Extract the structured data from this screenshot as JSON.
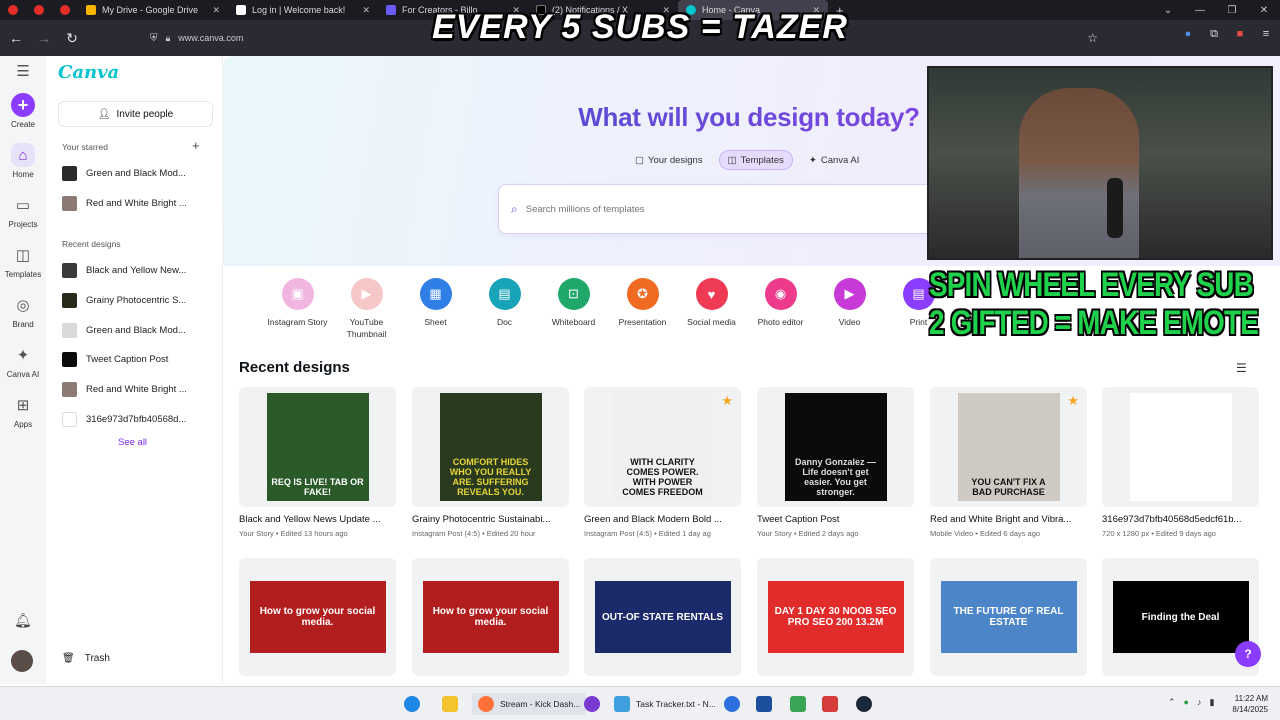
{
  "browser": {
    "tabs": [
      {
        "title": "My Drive - Google Drive",
        "color": "#f4b400"
      },
      {
        "title": "Log in | Welcome back!",
        "color": "#ffffff"
      },
      {
        "title": "For Creators - Billo",
        "color": "#6b5bff"
      },
      {
        "title": "(2) Notifications / X",
        "color": "#000000"
      },
      {
        "title": "Home - Canva",
        "color": "#00c4cc"
      }
    ],
    "url": "www.canva.com"
  },
  "overlay": {
    "top_banner": "EVERY 5 SUBS = TAZER",
    "side_line1": "SPIN WHEEL EVERY SUB",
    "side_line2": "2 GIFTED = MAKE EMOTE"
  },
  "rail": {
    "create": "Create",
    "home": "Home",
    "projects": "Projects",
    "templates": "Templates",
    "brand": "Brand",
    "canva_ai": "Canva AI",
    "apps": "Apps"
  },
  "sidepanel": {
    "logo": "Canva",
    "invite": "Invite people",
    "starred_heading": "Your starred",
    "starred": [
      "Green and Black Mod...",
      "Red and White Bright ..."
    ],
    "recent_heading": "Recent designs",
    "recent": [
      "Black and Yellow New...",
      "Grainy Photocentric S...",
      "Green and Black Mod...",
      "Tweet Caption Post",
      "Red and White Bright ...",
      "316e973d7bfb40568d..."
    ],
    "see_all": "See all",
    "trash": "Trash"
  },
  "hero": {
    "title": "What will you design today?",
    "modes": [
      "Your designs",
      "Templates",
      "Canva AI"
    ],
    "active_mode": "Templates",
    "search_placeholder": "Search millions of templates"
  },
  "design_types": [
    {
      "label": "Instagram Story",
      "color": "#f1b6e0"
    },
    {
      "label": "YouTube Thumbnail",
      "color": "#f5c7c7"
    },
    {
      "label": "Sheet",
      "color": "#2f7fe6"
    },
    {
      "label": "Doc",
      "color": "#17a3b8"
    },
    {
      "label": "Whiteboard",
      "color": "#20a86a"
    },
    {
      "label": "Presentation",
      "color": "#f06a22"
    },
    {
      "label": "Social media",
      "color": "#ee3a55"
    },
    {
      "label": "Photo editor",
      "color": "#ee3a8a"
    },
    {
      "label": "Video",
      "color": "#c83ad8"
    },
    {
      "label": "Print",
      "color": "#8b3dff"
    }
  ],
  "recent": {
    "heading": "Recent designs",
    "row1": [
      {
        "name": "Black and Yellow News Update ...",
        "meta": "Your Story • Edited 13 hours ago",
        "art_text": "REQ IS LIVE! TAB OR FAKE!",
        "bg": "#2b5a2a",
        "fg": "#ffffff"
      },
      {
        "name": "Grainy Photocentric Sustainabi...",
        "meta": "Instagram Post (4:5) • Edited 20 hour",
        "art_text": "COMFORT HIDES WHO YOU REALLY ARE. SUFFERING REVEALS YOU.",
        "bg": "#2a3a1e",
        "fg": "#e6d63a"
      },
      {
        "name": "Green and Black Modern Bold ...",
        "meta": "Instagram Post (4:5) • Edited 1 day ag",
        "art_text": "WITH CLARITY COMES POWER. WITH POWER COMES FREEDOM",
        "bg": "#f0f0f0",
        "fg": "#111111"
      },
      {
        "name": "Tweet Caption Post",
        "meta": "Your Story • Edited 2 days ago",
        "art_text": "Danny Gonzalez — Life doesn't get easier. You get stronger.",
        "bg": "#0b0b0b",
        "fg": "#dddddd"
      },
      {
        "name": "Red and White Bright and Vibra...",
        "meta": "Mobile Video • Edited 6 days ago",
        "art_text": "YOU CAN'T FIX A BAD PURCHASE",
        "bg": "#cfc9c4",
        "fg": "#111111"
      },
      {
        "name": "316e973d7bfb40568d5edcf61b...",
        "meta": "720 x 1280 px • Edited 9 days ago",
        "art_text": "",
        "bg": "#ffffff",
        "fg": "#111111"
      }
    ],
    "row2": [
      {
        "art_text": "How to grow your social media.",
        "bg": "#b21d1d"
      },
      {
        "art_text": "How to grow your social media.",
        "bg": "#b21d1d"
      },
      {
        "art_text": "OUT-OF STATE RENTALS",
        "bg": "#1b2a6a"
      },
      {
        "art_text": "DAY 1  DAY 30  NOOB SEO  PRO SEO  200  13.2M",
        "bg": "#e22b2b"
      },
      {
        "art_text": "THE FUTURE OF REAL ESTATE",
        "bg": "#4d86c8"
      },
      {
        "art_text": "Finding the Deal",
        "bg": "#000000"
      }
    ]
  },
  "help": "?",
  "taskbar": {
    "items": [
      "Stream - Kick Dash...",
      "Task Tracker.txt - N..."
    ],
    "time": "11:22 AM",
    "date": "8/14/2025"
  }
}
